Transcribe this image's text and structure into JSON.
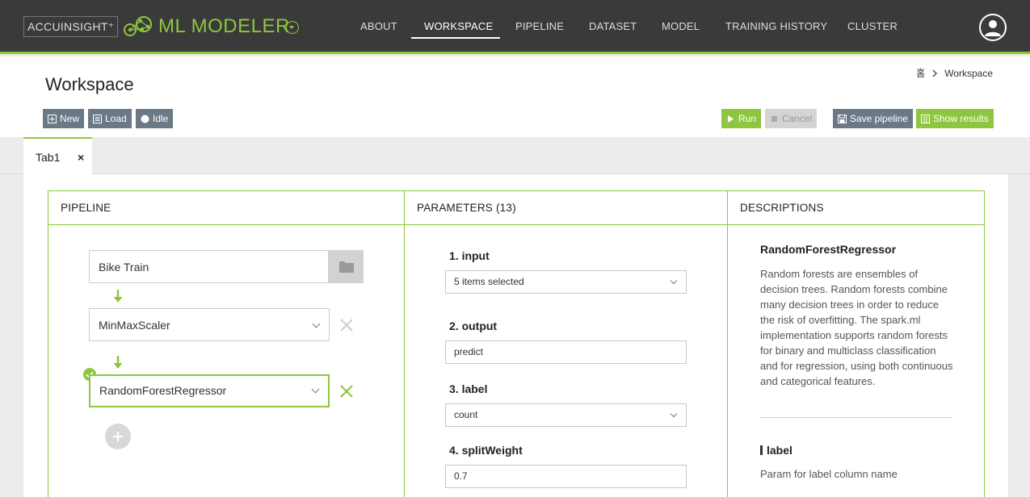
{
  "brand": {
    "company": "ACCUINSIGHT⁺",
    "product": "ML MODELER"
  },
  "nav": {
    "items": [
      {
        "label": "ABOUT"
      },
      {
        "label": "WORKSPACE",
        "active": true
      },
      {
        "label": "PIPELINE"
      },
      {
        "label": "DATASET"
      },
      {
        "label": "MODEL"
      },
      {
        "label": "TRAINING HISTORY"
      },
      {
        "label": "CLUSTER"
      }
    ]
  },
  "header": {
    "title": "Workspace",
    "breadcrumb": {
      "home": "홈",
      "current": "Workspace"
    }
  },
  "toolbar": {
    "new_label": "New",
    "load_label": "Load",
    "status_label": "Idle",
    "run_label": "Run",
    "cancel_label": "Cancel",
    "save_label": "Save pipeline",
    "results_label": "Show results"
  },
  "tabs": [
    {
      "label": "Tab1",
      "close": "×"
    }
  ],
  "panels": {
    "pipeline": {
      "heading": "PIPELINE",
      "dataset": "Bike Train",
      "nodes": [
        {
          "label": "MinMaxScaler"
        },
        {
          "label": "RandomForestRegressor",
          "selected": true
        }
      ]
    },
    "parameters": {
      "heading": "PARAMETERS (13)",
      "items": [
        {
          "label": "1. input",
          "value": "5 items selected",
          "type": "select"
        },
        {
          "label": "2. output",
          "value": "predict",
          "type": "text"
        },
        {
          "label": "3. label",
          "value": "count",
          "type": "select"
        },
        {
          "label": "4. splitWeight",
          "value": "0.7",
          "type": "text"
        }
      ]
    },
    "descriptions": {
      "heading": "DESCRIPTIONS",
      "title": "RandomForestRegressor",
      "text": "Random forests are ensembles of decision trees. Random forests combine many decision trees in order to reduce the risk of overfitting. The spark.ml implementation supports random forests for binary and multiclass classification and for regression, using both continuous and categorical features.",
      "param_name": "label",
      "param_text": "Param for label column name"
    }
  },
  "colors": {
    "accent": "#8ec63f",
    "topbar": "#3a3a3a",
    "button_gray": "#6b7886"
  }
}
